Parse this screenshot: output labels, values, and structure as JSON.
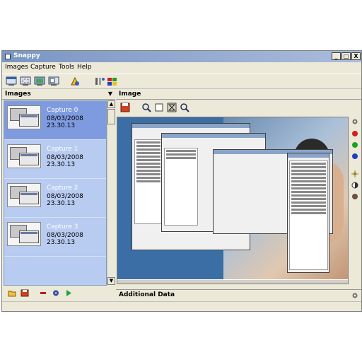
{
  "window": {
    "title": "Snappy",
    "controls": [
      "_",
      "□",
      "X"
    ]
  },
  "menu": [
    "Images",
    "Capture",
    "Tools",
    "Help"
  ],
  "left_panel": {
    "header": "Images",
    "captures": [
      {
        "name": "Capture 0",
        "date": "08/03/2008 23.30.13",
        "selected": true
      },
      {
        "name": "Capture 1",
        "date": "08/03/2008 23.30.13",
        "selected": false
      },
      {
        "name": "Capture 2",
        "date": "08/03/2008 23.30.13",
        "selected": false
      },
      {
        "name": "Capture 3",
        "date": "08/03/2008 23.30.13",
        "selected": false
      }
    ]
  },
  "right_panel": {
    "header": "Image",
    "additional_header": "Additional Data"
  },
  "colors": {
    "selected_item": "#7f9be0",
    "item_bg": "#b8cbf0",
    "dot_red": "#d02020",
    "dot_green": "#20a020",
    "dot_blue": "#2040c0"
  },
  "icons": {
    "toolbar": [
      "capture-window-icon",
      "capture-region-icon",
      "capture-screen-icon",
      "capture-menu-icon",
      "timer-icon",
      "tools-icon",
      "export-icon"
    ],
    "image_toolbar": [
      "save-icon",
      "zoom-icon",
      "fit-icon",
      "actual-size-icon",
      "zoom-in-icon"
    ],
    "left_bottom": [
      "open-folder-icon",
      "save-icon",
      "delete-icon",
      "settings-icon",
      "play-icon"
    ]
  }
}
